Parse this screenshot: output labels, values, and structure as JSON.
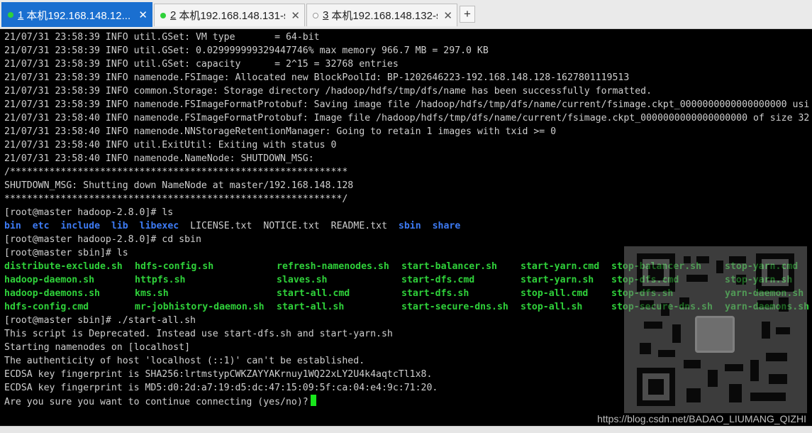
{
  "tabs": [
    {
      "num": "1",
      "title": "本机192.168.148.12...",
      "dot_color": "#2fd13a",
      "active": true
    },
    {
      "num": "2",
      "title": "本机192.168.148.131-s...",
      "dot_color": "#2fd13a",
      "active": false
    },
    {
      "num": "3",
      "title": "本机192.168.148.132-s...",
      "dot_color": "#ffffff",
      "active": false
    }
  ],
  "add_tab_label": "+",
  "terminal": {
    "log_lines": [
      "21/07/31 23:58:39 INFO util.GSet: VM type       = 64-bit",
      "21/07/31 23:58:39 INFO util.GSet: 0.029999999329447746% max memory 966.7 MB = 297.0 KB",
      "21/07/31 23:58:39 INFO util.GSet: capacity      = 2^15 = 32768 entries",
      "21/07/31 23:58:39 INFO namenode.FSImage: Allocated new BlockPoolId: BP-1202646223-192.168.148.128-1627801119513",
      "21/07/31 23:58:39 INFO common.Storage: Storage directory /hadoop/hdfs/tmp/dfs/name has been successfully formatted.",
      "21/07/31 23:58:39 INFO namenode.FSImageFormatProtobuf: Saving image file /hadoop/hdfs/tmp/dfs/name/current/fsimage.ckpt_0000000000000000000 usi",
      "21/07/31 23:58:40 INFO namenode.FSImageFormatProtobuf: Image file /hadoop/hdfs/tmp/dfs/name/current/fsimage.ckpt_0000000000000000000 of size 32",
      "21/07/31 23:58:40 INFO namenode.NNStorageRetentionManager: Going to retain 1 images with txid >= 0",
      "21/07/31 23:58:40 INFO util.ExitUtil: Exiting with status 0",
      "21/07/31 23:58:40 INFO namenode.NameNode: SHUTDOWN_MSG:",
      "/************************************************************",
      "SHUTDOWN_MSG: Shutting down NameNode at master/192.168.148.128",
      "************************************************************/"
    ],
    "prompt_ls1": "[root@master hadoop-2.8.0]# ls",
    "ls1_entries": [
      {
        "name": "bin",
        "kind": "dir"
      },
      {
        "name": "etc",
        "kind": "dir"
      },
      {
        "name": "include",
        "kind": "dir"
      },
      {
        "name": "lib",
        "kind": "dir"
      },
      {
        "name": "libexec",
        "kind": "dir"
      },
      {
        "name": "LICENSE.txt",
        "kind": "file"
      },
      {
        "name": "NOTICE.txt",
        "kind": "file"
      },
      {
        "name": "README.txt",
        "kind": "file"
      },
      {
        "name": "sbin",
        "kind": "dir"
      },
      {
        "name": "share",
        "kind": "dir"
      }
    ],
    "prompt_cd": "[root@master hadoop-2.8.0]# cd sbin",
    "prompt_ls2": "[root@master sbin]# ls",
    "sbin_rows": [
      [
        "distribute-exclude.sh",
        "hdfs-config.sh",
        "refresh-namenodes.sh",
        "start-balancer.sh",
        "start-yarn.cmd",
        "stop-balancer.sh",
        "stop-yarn.cmd"
      ],
      [
        "hadoop-daemon.sh",
        "httpfs.sh",
        "slaves.sh",
        "start-dfs.cmd",
        "start-yarn.sh",
        "stop-dfs.cmd",
        "stop-yarn.sh"
      ],
      [
        "hadoop-daemons.sh",
        "kms.sh",
        "start-all.cmd",
        "start-dfs.sh",
        "stop-all.cmd",
        "stop-dfs.sh",
        "yarn-daemon.sh"
      ],
      [
        "hdfs-config.cmd",
        "mr-jobhistory-daemon.sh",
        "start-all.sh",
        "start-secure-dns.sh",
        "stop-all.sh",
        "stop-secure-dns.sh",
        "yarn-daemons.sh"
      ]
    ],
    "prompt_start": "[root@master sbin]# ./start-all.sh",
    "tail_lines": [
      "This script is Deprecated. Instead use start-dfs.sh and start-yarn.sh",
      "Starting namenodes on [localhost]",
      "The authenticity of host 'localhost (::1)' can't be established.",
      "ECDSA key fingerprint is SHA256:lrtmstypCWKZAYYAKrnuy1WQ22xLY2U4k4aqtcTl1x8.",
      "ECDSA key fingerprint is MD5:d0:2d:a7:19:d5:dc:47:15:09:5f:ca:04:e4:9c:71:20."
    ],
    "final_prompt": "Are you sure you want to continue connecting (yes/no)?"
  },
  "watermark": "https://blog.csdn.net/BADAO_LIUMANG_QIZHI",
  "colors": {
    "active_tab": "#1a6fd0",
    "directory": "#3d7bf5",
    "executable": "#2fd13a",
    "cursor": "#19e61c",
    "text": "#cfcfcf"
  }
}
